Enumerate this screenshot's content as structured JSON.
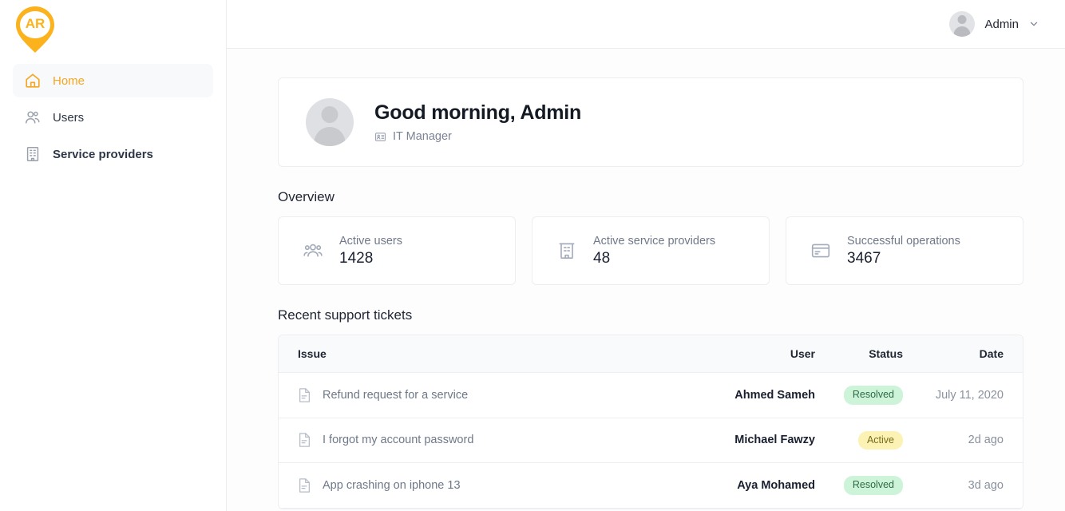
{
  "brand": {
    "logo_text": "AR",
    "logo_color": "#fbb21c"
  },
  "sidebar": {
    "items": [
      {
        "label": "Home",
        "icon": "home-icon",
        "active": true
      },
      {
        "label": "Users",
        "icon": "users-icon",
        "active": false
      },
      {
        "label": "Service providers",
        "icon": "building-icon",
        "active": false
      }
    ]
  },
  "topbar": {
    "user_name": "Admin",
    "avatar_icon": "avatar",
    "caret_icon": "chevron-down-icon"
  },
  "welcome": {
    "greeting": "Good morning, Admin",
    "role": "IT Manager",
    "role_icon": "id-badge-icon"
  },
  "overview": {
    "title": "Overview",
    "cards": [
      {
        "label": "Active users",
        "value": "1428",
        "icon": "users-group-icon"
      },
      {
        "label": "Active service providers",
        "value": "48",
        "icon": "building-icon"
      },
      {
        "label": "Successful operations",
        "value": "3467",
        "icon": "credit-card-icon"
      }
    ]
  },
  "tickets": {
    "title": "Recent support tickets",
    "columns": {
      "issue": "Issue",
      "user": "User",
      "status": "Status",
      "date": "Date"
    },
    "rows": [
      {
        "issue": "Refund request for a service",
        "user": "Ahmed Sameh",
        "status": "Resolved",
        "status_kind": "resolved",
        "date": "July 11, 2020",
        "icon": "document-icon"
      },
      {
        "issue": "I forgot my account password",
        "user": "Michael Fawzy",
        "status": "Active",
        "status_kind": "active",
        "date": "2d ago",
        "icon": "document-icon"
      },
      {
        "issue": "App crashing on iphone 13",
        "user": "Aya Mohamed",
        "status": "Resolved",
        "status_kind": "resolved",
        "date": "3d ago",
        "icon": "document-icon"
      }
    ]
  },
  "colors": {
    "accent": "#f5a623",
    "brand": "#fbb21c",
    "resolved_bg": "#cdf3d9",
    "resolved_fg": "#2f6b45",
    "active_bg": "#fbf2b4",
    "active_fg": "#7a6a1d"
  }
}
